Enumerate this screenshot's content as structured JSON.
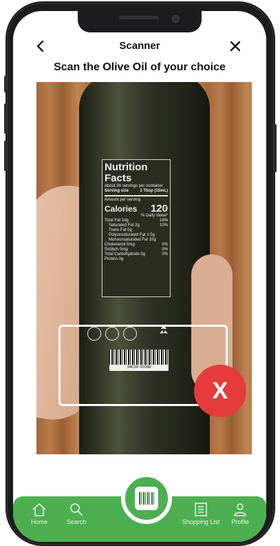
{
  "header": {
    "title": "Scanner",
    "back_icon": "chevron-left-icon",
    "close_icon": "close-icon"
  },
  "instruction": "Scan the Olive Oil of your choice",
  "product_label": {
    "heading": "Nutrition Facts",
    "servings": "About 34 servings per container",
    "serving_size_label": "Serving size",
    "serving_size": "1 Tbsp (15mL)",
    "amount_per_serving": "Amount per serving",
    "calories_label": "Calories",
    "calories": "120",
    "daily_value": "% Daily Value*",
    "rows": [
      {
        "label": "Total Fat 14g",
        "value": "18%"
      },
      {
        "label": "Saturated Fat 2g",
        "value": "10%"
      },
      {
        "label": "Trans Fat 0g",
        "value": ""
      },
      {
        "label": "Polyunsaturated Fat 1.5g",
        "value": ""
      },
      {
        "label": "Monounsaturated Fat 10g",
        "value": ""
      },
      {
        "label": "Cholesterol 0mg",
        "value": "0%"
      },
      {
        "label": "Sodium 0mg",
        "value": "0%"
      },
      {
        "label": "Total Carbohydrate 0g",
        "value": "0%"
      },
      {
        "label": "Protein 0g",
        "value": ""
      }
    ],
    "barcode_number": "34039 00068"
  },
  "scan_action": {
    "reject_label": "X",
    "color": "#e63b3b"
  },
  "nav": {
    "color": "#4caf50",
    "items": [
      {
        "label": "Home",
        "icon": "home-icon"
      },
      {
        "label": "Search",
        "icon": "search-icon"
      },
      {
        "label": "Shopping List",
        "icon": "list-icon"
      },
      {
        "label": "Profile",
        "icon": "user-icon"
      }
    ],
    "center_icon": "barcode-icon"
  }
}
